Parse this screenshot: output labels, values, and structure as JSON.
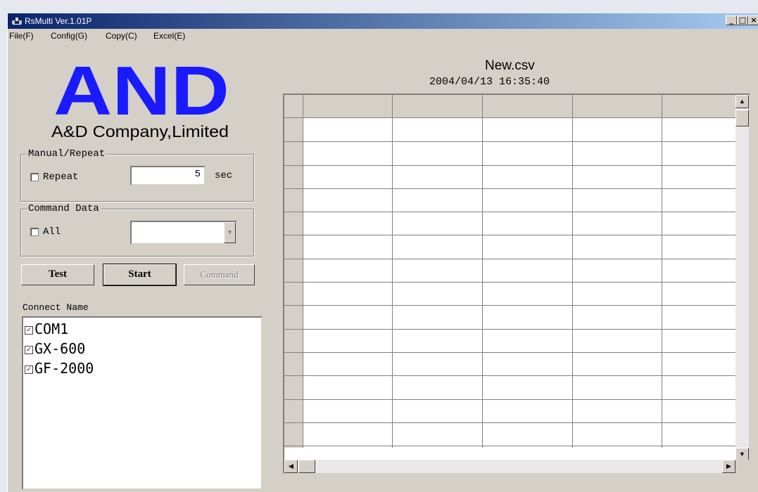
{
  "window": {
    "title": "RsMulti Ver.1.01P",
    "controls": [
      "_",
      "□",
      "×"
    ]
  },
  "menu": [
    {
      "label": "File(F)"
    },
    {
      "label": "Config(G)"
    },
    {
      "label": "Copy(C)"
    },
    {
      "label": "Excel(E)"
    }
  ],
  "logo": {
    "text": "AND",
    "company": "A&D Company,Limited"
  },
  "manual_repeat": {
    "group_label": "Manual/Repeat",
    "checkbox_label": "Repeat",
    "interval_value": "5",
    "unit": "sec"
  },
  "command_data": {
    "group_label": "Command Data",
    "checkbox_label": "All",
    "selected_value": ""
  },
  "buttons": {
    "test": "Test",
    "start": "Start",
    "command": "Command"
  },
  "connect": {
    "label": "Connect Name",
    "items": [
      {
        "name": "COM1",
        "checked": true
      },
      {
        "name": "GX-600",
        "checked": true
      },
      {
        "name": "GF-2000",
        "checked": true
      }
    ]
  },
  "file": {
    "name": "New.csv",
    "datetime": "2004/04/13 16:35:40"
  },
  "colors": {
    "titlebar_start": "#0a246a",
    "titlebar_end": "#a6caf0",
    "logo_blue": "#1a1aff",
    "window_bg": "#d4d0c8"
  }
}
